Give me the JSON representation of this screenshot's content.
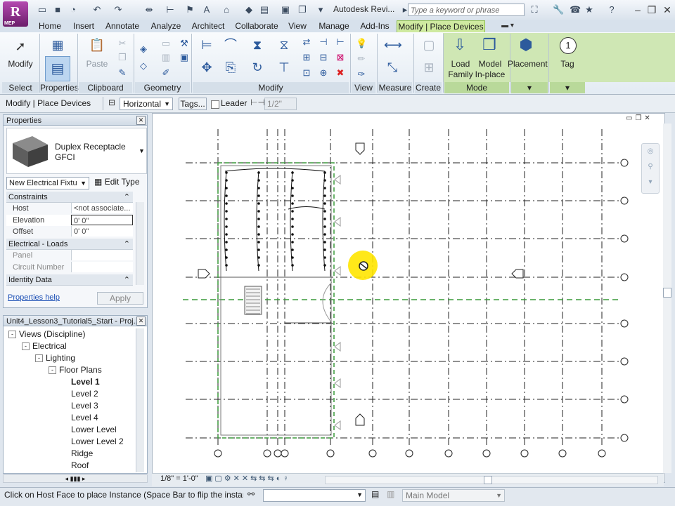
{
  "app": {
    "logo_letter": "R",
    "logo_sub": "MEP",
    "title": "Autodesk Revi...",
    "search_placeholder": "Type a keyword or phrase"
  },
  "tabs": [
    "Home",
    "Insert",
    "Annotate",
    "Analyze",
    "Architect",
    "Collaborate",
    "View",
    "Manage",
    "Add-Ins",
    "Modify | Place Devices"
  ],
  "ribbon": {
    "modify_label": "Modify",
    "paste_label": "Paste",
    "load_family_label": "Load\nFamily",
    "model_inplace_label": "Model\nIn-place",
    "placement_label": "Placement",
    "tag_label": "Tag",
    "panels": [
      "Select",
      "Properties",
      "Clipboard",
      "Geometry",
      "Modify",
      "View",
      "Measure",
      "Create",
      "Mode"
    ]
  },
  "options_bar": {
    "context": "Modify | Place Devices",
    "orientation": "Horizontal",
    "tags_button": "Tags...",
    "leader_label": "Leader",
    "leader_length": "1/2\""
  },
  "properties": {
    "title": "Properties",
    "type_name": "Duplex Receptacle",
    "type_sub": "GFCI",
    "instance_filter": "New Electrical Fixtu",
    "edit_type": "Edit Type",
    "groups": {
      "constraints": "Constraints",
      "electrical": "Electrical - Loads",
      "identity": "Identity Data"
    },
    "rows": {
      "host": {
        "k": "Host",
        "v": "<not associate..."
      },
      "elevation": {
        "k": "Elevation",
        "v": "0'  0\""
      },
      "offset": {
        "k": "Offset",
        "v": "0'  0\""
      },
      "panel": {
        "k": "Panel",
        "v": ""
      },
      "circuit": {
        "k": "Circuit Number",
        "v": ""
      }
    },
    "help_link": "Properties help",
    "apply_button": "Apply"
  },
  "browser": {
    "title": "Unit4_Lesson3_Tutorial5_Start - Proj...",
    "items": [
      {
        "label": "Views (Discipline)",
        "indent": 0,
        "toggle": "-"
      },
      {
        "label": "Electrical",
        "indent": 1,
        "toggle": "-"
      },
      {
        "label": "Lighting",
        "indent": 2,
        "toggle": "-"
      },
      {
        "label": "Floor Plans",
        "indent": 3,
        "toggle": "-"
      },
      {
        "label": "Level 1",
        "indent": 4,
        "toggle": ""
      },
      {
        "label": "Level 2",
        "indent": 4,
        "toggle": ""
      },
      {
        "label": "Level 3",
        "indent": 4,
        "toggle": ""
      },
      {
        "label": "Level 4",
        "indent": 4,
        "toggle": ""
      },
      {
        "label": "Lower Level",
        "indent": 4,
        "toggle": ""
      },
      {
        "label": "Lower Level 2",
        "indent": 4,
        "toggle": ""
      },
      {
        "label": "Ridge",
        "indent": 4,
        "toggle": ""
      },
      {
        "label": "Roof",
        "indent": 4,
        "toggle": ""
      }
    ]
  },
  "view_controls": {
    "scale": "1/8\" = 1'-0\""
  },
  "status_bar": {
    "message": "Click on Host Face to place Instance (Space Bar to flip the instance let",
    "workset": "Main Model"
  },
  "colors": {
    "active_tab": "#cfeaa0",
    "highlight_cursor": "#ffe600",
    "grid_line": "#222222",
    "reference_plane": "#3a9a3a"
  }
}
